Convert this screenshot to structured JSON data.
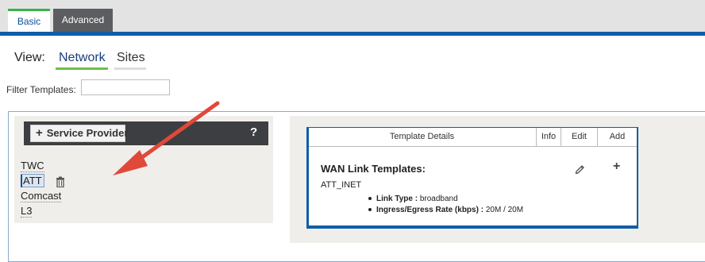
{
  "tabs": {
    "basic": "Basic",
    "advanced": "Advanced"
  },
  "view": {
    "label": "View:",
    "network": "Network",
    "sites": "Sites"
  },
  "filter": {
    "label": "Filter Templates:",
    "value": "",
    "placeholder": ""
  },
  "service_provider": {
    "button_label": "Service Provider",
    "help": "?",
    "items": [
      "TWC",
      "ATT",
      "Comcast",
      "L3"
    ],
    "selected": "ATT"
  },
  "template_details": {
    "headers": {
      "title": "Template Details",
      "info": "Info",
      "edit": "Edit",
      "add": "Add"
    },
    "wan_title": "WAN Link Templates:",
    "template_name": "ATT_INET",
    "details": [
      {
        "label": "Link Type :",
        "value": "broadband"
      },
      {
        "label": "Ingress/Egress Rate (kbps) :",
        "value": "20M / 20M"
      }
    ]
  },
  "colors": {
    "accent_blue": "#0f5ea8",
    "accent_green": "#6cc04a",
    "annotation_arrow": "#e0483a"
  },
  "icons": {
    "trash": "trash-icon",
    "pencil": "pencil-icon",
    "plus": "plus-icon"
  }
}
